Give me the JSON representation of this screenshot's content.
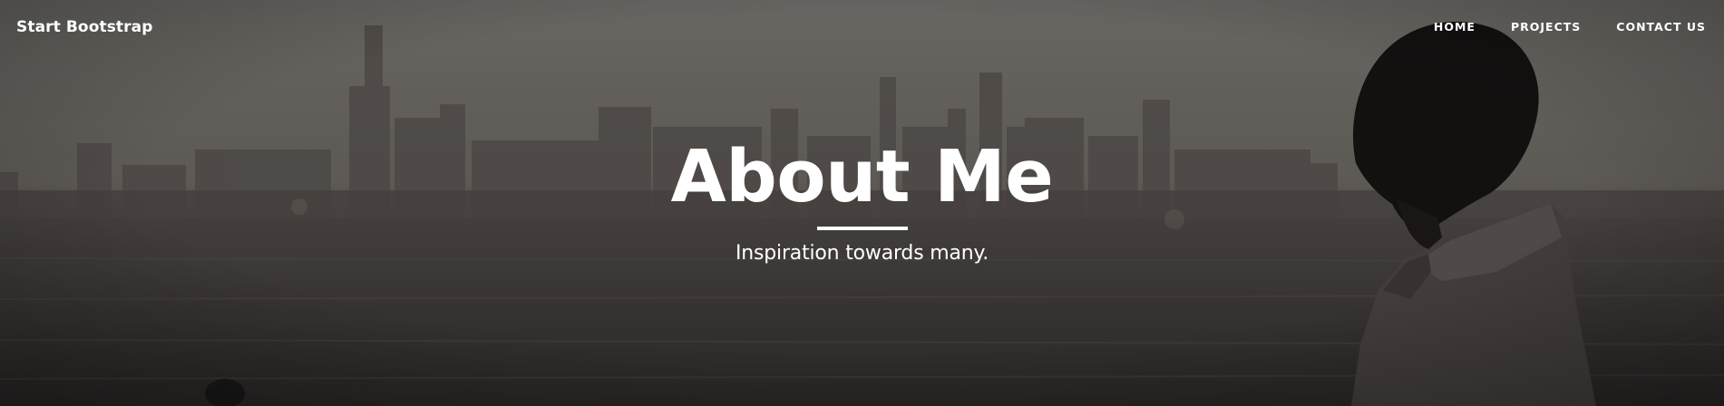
{
  "navbar": {
    "brand": "Start Bootstrap",
    "links": [
      {
        "label": "HOME"
      },
      {
        "label": "PROJECTS"
      },
      {
        "label": "CONTACT US"
      }
    ]
  },
  "masthead": {
    "title": "About Me",
    "subtitle": "Inspiration towards many."
  },
  "colors": {
    "text": "#ffffff",
    "overlay": "#3e3b39",
    "sky": "#6f6d68"
  },
  "background_image": "city-skyline-lake-man-silhouette"
}
